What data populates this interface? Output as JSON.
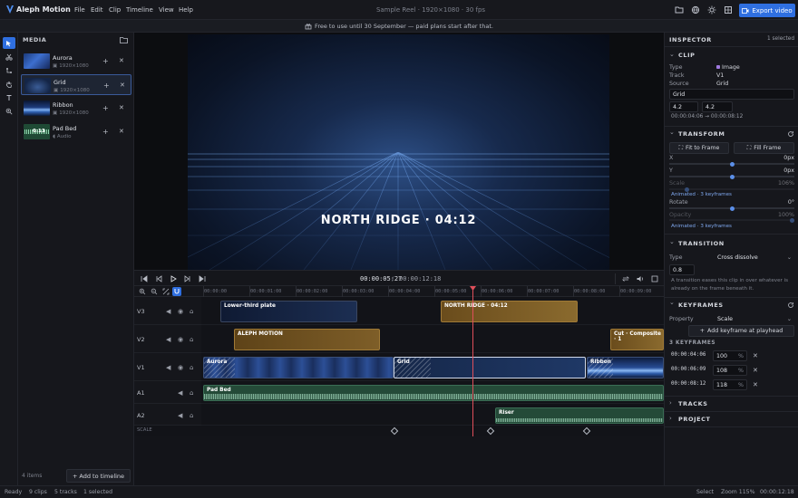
{
  "app": {
    "title": "Aleph Motion",
    "doc_title": "Sample Reel · 1920×1080 · 30 fps",
    "export_label": "Export video"
  },
  "menu": [
    "File",
    "Edit",
    "Clip",
    "Timeline",
    "View",
    "Help"
  ],
  "banner": "Free to use until 30 September — paid plans start after that.",
  "media": {
    "title": "MEDIA",
    "items": [
      {
        "name": "Aurora",
        "meta": "1920×1080"
      },
      {
        "name": "Grid",
        "meta": "1920×1080"
      },
      {
        "name": "Ribbon",
        "meta": "1920×1080"
      },
      {
        "name": "Pad Bed",
        "meta": "Audio",
        "badge": "0:13"
      }
    ],
    "count": "4 items",
    "add_label": "Add to timeline"
  },
  "viewer": {
    "overlay": "NORTH RIDGE  ·  04:12"
  },
  "transport": {
    "current": "00:00:05:27",
    "sep": "/",
    "total": "00:00:12:18"
  },
  "ruler": [
    "00:00:00",
    "00:00:01:00",
    "00:00:02:00",
    "00:00:03:00",
    "00:00:04:00",
    "00:00:05:00",
    "00:00:06:00",
    "00:00:07:00",
    "00:00:08:00",
    "00:00:09:00"
  ],
  "tracks": [
    {
      "name": "V3",
      "clips": [
        {
          "name": "Lower-third plate"
        },
        {
          "name": "NORTH RIDGE · 04:12"
        }
      ]
    },
    {
      "name": "V2",
      "clips": [
        {
          "name": "ALEPH MOTION"
        },
        {
          "name": "Cut · Composite · 1"
        }
      ]
    },
    {
      "name": "V1",
      "clips": [
        {
          "name": "Aurora"
        },
        {
          "name": "Grid"
        },
        {
          "name": "Ribbon"
        }
      ]
    },
    {
      "name": "A1",
      "clips": [
        {
          "name": "Pad Bed"
        }
      ]
    },
    {
      "name": "A2",
      "clips": [
        {
          "name": "Riser"
        }
      ]
    }
  ],
  "scale_label": "SCALE",
  "inspector": {
    "title": "INSPECTOR",
    "selected": "1 selected",
    "clip": {
      "header": "CLIP",
      "type_label": "Type",
      "type_value": "Image",
      "track_label": "Track",
      "track_value": "V1",
      "source_label": "Source",
      "source_value": "Grid",
      "name_value": "Grid",
      "in_value": "4.2",
      "out_value": "4.2",
      "range": "00:00:04:06 → 00:00:08:12"
    },
    "transform": {
      "header": "TRANSFORM",
      "fit_label": "Fit to Frame",
      "fill_label": "Fill Frame",
      "x_label": "X",
      "x_value": "0px",
      "y_label": "Y",
      "y_value": "0px",
      "scale_label": "Scale",
      "scale_value": "106%",
      "scale_note": "Animated · 3 keyframes",
      "rotate_label": "Rotate",
      "rotate_value": "0°",
      "opacity_label": "Opacity",
      "opacity_value": "100%",
      "opacity_note": "Animated · 3 keyframes"
    },
    "transition": {
      "header": "TRANSITION",
      "type_label": "Type",
      "type_value": "Cross dissolve",
      "duration_value": "0.8",
      "note": "A transition eases this clip in over whatever is already on the frame beneath it."
    },
    "keyframes": {
      "header": "KEYFRAMES",
      "property_label": "Property",
      "property_value": "Scale",
      "add_label": "Add keyframe at playhead",
      "count_label": "3 KEYFRAMES",
      "items": [
        {
          "time": "00:00:04:06",
          "value": "100",
          "unit": "%"
        },
        {
          "time": "00:00:06:09",
          "value": "108",
          "unit": "%"
        },
        {
          "time": "00:00:08:12",
          "value": "118",
          "unit": "%"
        }
      ]
    },
    "tracks_header": "TRACKS",
    "project_header": "PROJECT"
  },
  "status": {
    "ready": "Ready",
    "clips": "9 clips",
    "tracks": "5 tracks",
    "selected": "1 selected",
    "select": "Select",
    "zoom": "Zoom 115%",
    "time": "00:00:12:18"
  },
  "colors": {
    "accent": "#2f6fe0",
    "playhead": "#e04f5a",
    "video_clip": "#1a2a48",
    "gold_clip": "#7a5a22",
    "audio_clip": "#2c5a44"
  }
}
